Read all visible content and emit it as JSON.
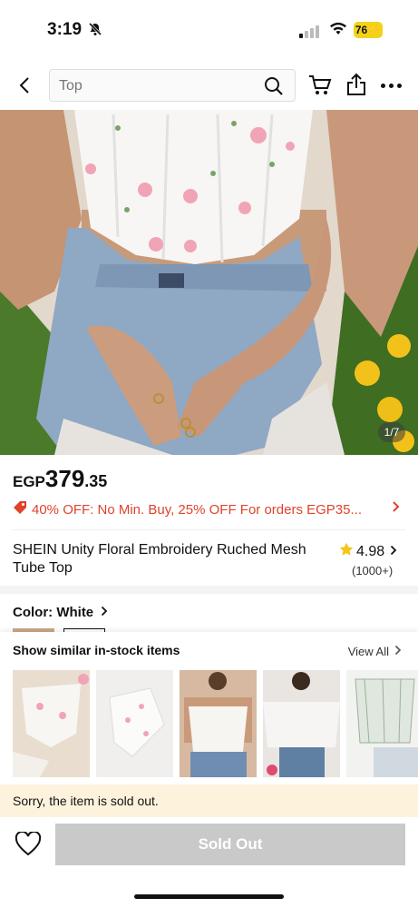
{
  "status": {
    "time": "3:19",
    "battery": "76"
  },
  "nav": {
    "search_placeholder": "Top"
  },
  "hero": {
    "counter": "1/7"
  },
  "price": {
    "currency": "EGP",
    "integer": "379",
    "decimal": ".35"
  },
  "promo": {
    "text": "40% OFF: No Min. Buy,  25% OFF For orders EGP35..."
  },
  "product": {
    "title": "SHEIN Unity Floral Embroidery Ruched Mesh Tube Top",
    "rating": "4.98",
    "review_count": "(1000+)"
  },
  "color": {
    "label": "Color: White"
  },
  "similar": {
    "heading": "Show similar in-stock items",
    "view_all": "View All"
  },
  "sold_message": "Sorry, the item is sold out.",
  "bottom": {
    "button_label": "Sold Out"
  },
  "colors": {
    "accent": "#e0422b",
    "star": "#f5c518",
    "battery": "#f3d21a",
    "notice_bg": "#fdf3dd",
    "disabled": "#c9c9c9"
  }
}
